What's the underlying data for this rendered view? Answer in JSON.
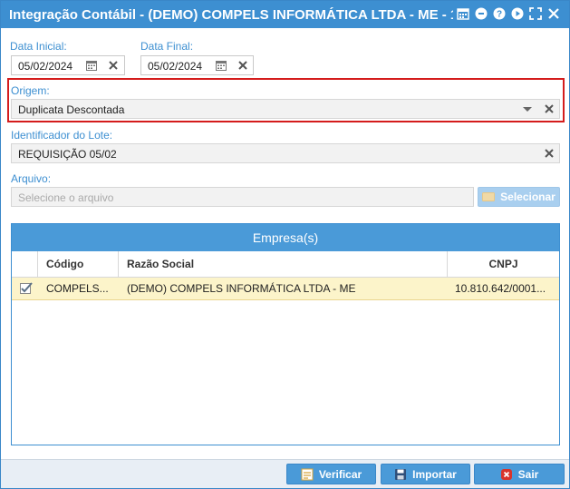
{
  "window": {
    "title": "Integração Contábil - (DEMO) COMPELS INFORMÁTICA LTDA - ME - 1...",
    "title_icons": [
      "calendar-icon",
      "minimize-icon",
      "help-icon",
      "play-icon",
      "maximize-icon",
      "close-icon"
    ]
  },
  "form": {
    "data_inicial": {
      "label": "Data Inicial:",
      "value": "05/02/2024"
    },
    "data_final": {
      "label": "Data Final:",
      "value": "05/02/2024"
    },
    "origem": {
      "label": "Origem:",
      "value": "Duplicata Descontada"
    },
    "identificador": {
      "label": "Identificador do Lote:",
      "value": "REQUISIÇÃO 05/02"
    },
    "arquivo": {
      "label": "Arquivo:",
      "placeholder": "Selecione o arquivo",
      "button_label": "Selecionar"
    }
  },
  "grid": {
    "title": "Empresa(s)",
    "columns": [
      "Código",
      "Razão Social",
      "CNPJ"
    ],
    "rows": [
      {
        "checked": true,
        "codigo": "COMPELS...",
        "razao_social": "(DEMO) COMPELS INFORMÁTICA LTDA - ME",
        "cnpj": "10.810.642/0001..."
      }
    ]
  },
  "footer": {
    "verificar": "Verificar",
    "importar": "Importar",
    "sair": "Sair"
  },
  "colors": {
    "titlebar": "#3d8fd1",
    "accent_label": "#3d8fd1",
    "highlight_border": "#d41c1c",
    "selected_row": "#fcf4ca",
    "exit_icon": "#d9342b"
  }
}
